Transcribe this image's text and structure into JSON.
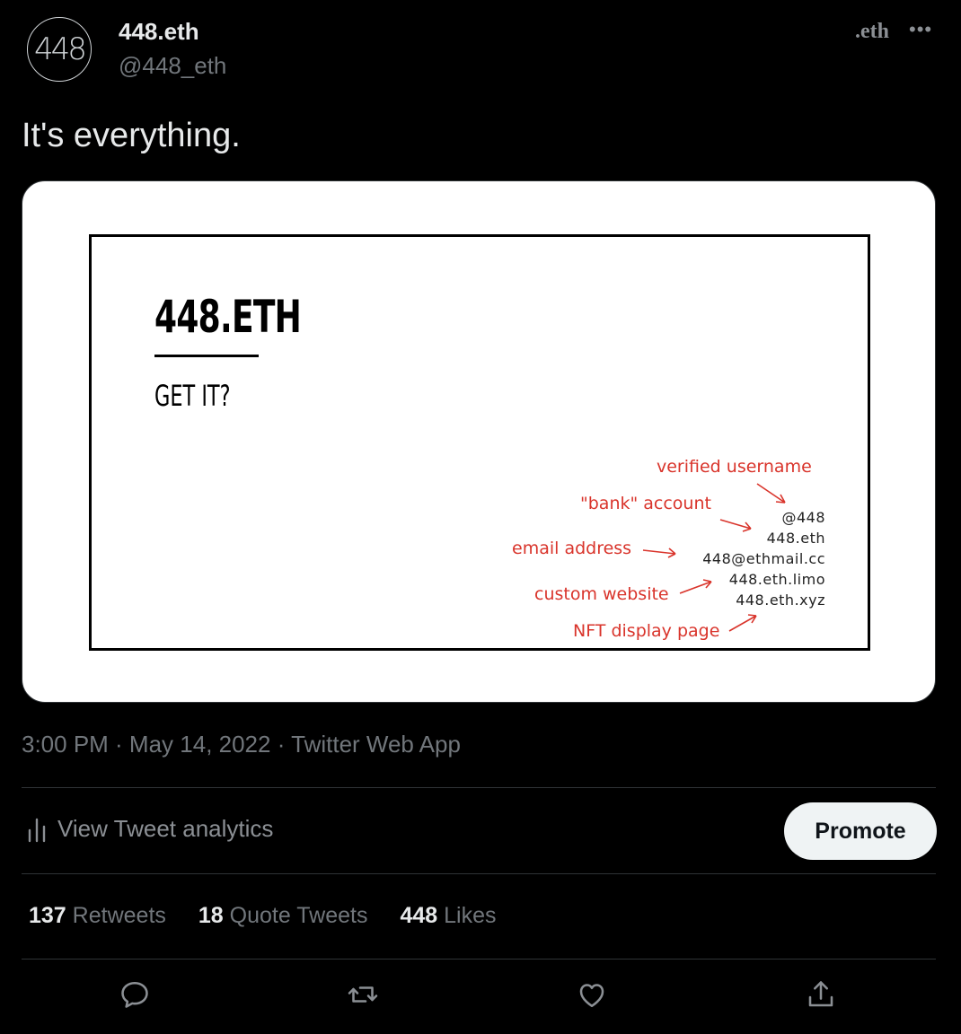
{
  "tweet": {
    "display_name": "448.eth",
    "handle": "@448_eth",
    "avatar_text": "448",
    "name_badge": ".eth",
    "more_label": "•••",
    "text": "It's everything.",
    "timestamp": "3:00 PM · May 14, 2022 · Twitter Web App"
  },
  "media_card": {
    "title": "448.ETH",
    "subtitle": "GET IT?",
    "annotations": {
      "verified_username": "verified username",
      "bank_account": "\"bank\" account",
      "email_address": "email address",
      "custom_website": "custom website",
      "nft_display_page": "NFT display page"
    },
    "values": {
      "username": "@448",
      "ens": "448.eth",
      "email": "448@ethmail.cc",
      "limo": "448.eth.limo",
      "xyz": "448.eth.xyz"
    }
  },
  "analytics": {
    "label": "View Tweet analytics"
  },
  "promote": {
    "label": "Promote"
  },
  "stats": {
    "retweets_count": "137",
    "retweets_label": "Retweets",
    "quotes_count": "18",
    "quotes_label": "Quote Tweets",
    "likes_count": "448",
    "likes_label": "Likes"
  },
  "actions": [
    "reply-icon",
    "retweet-icon",
    "like-icon",
    "share-icon"
  ],
  "colors": {
    "background": "#000000",
    "annotation_red": "#d9342b",
    "promote_bg": "#eff3f4"
  }
}
